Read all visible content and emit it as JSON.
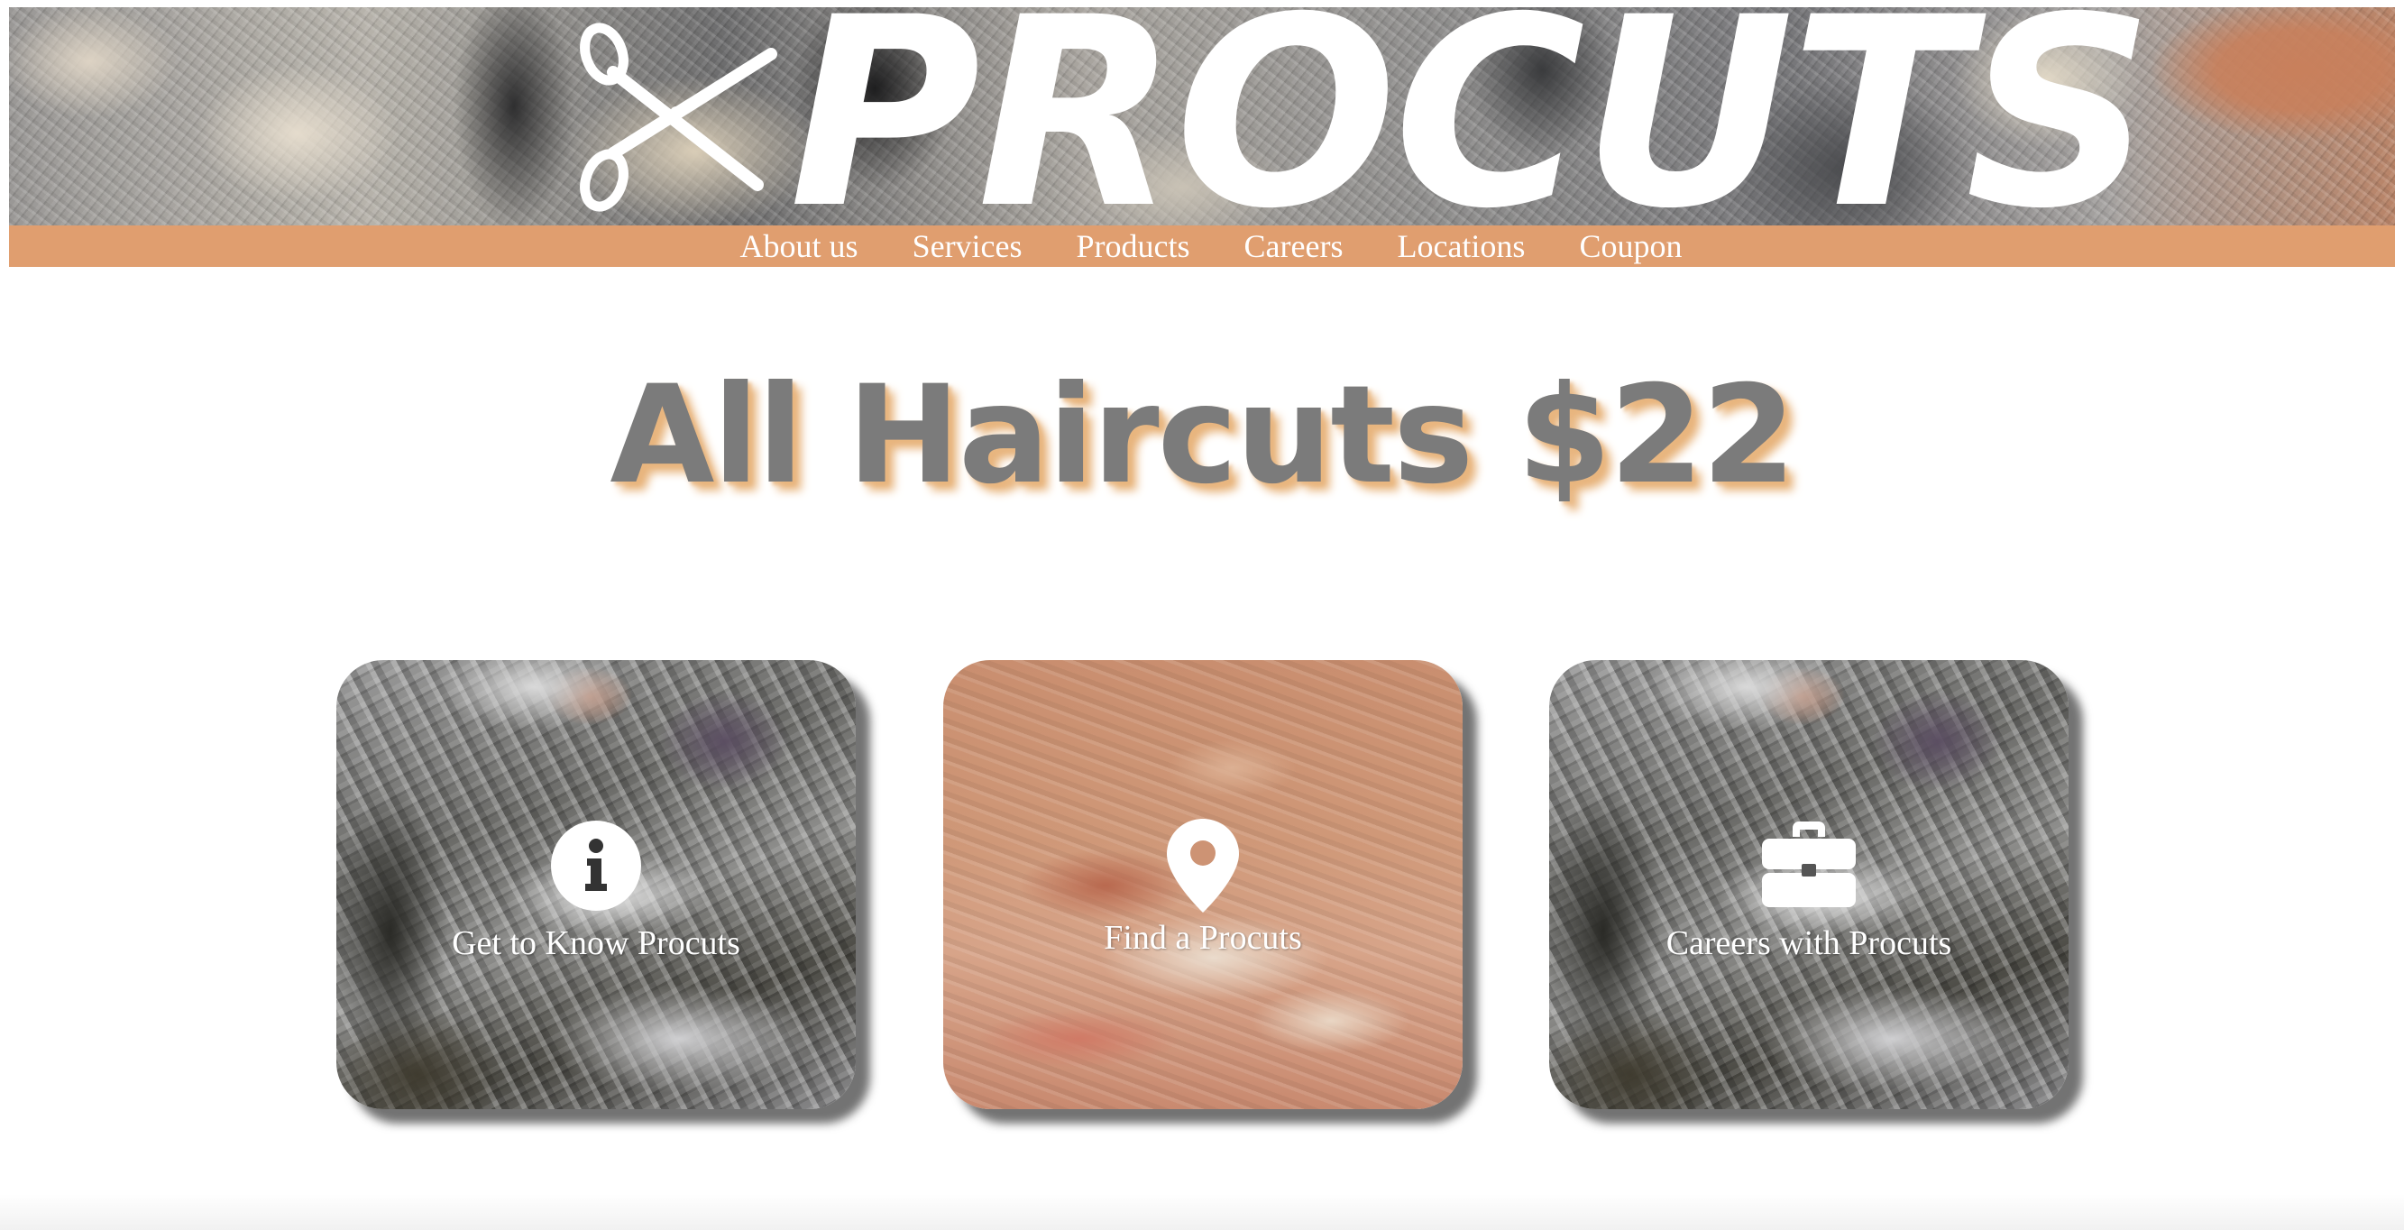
{
  "site": {
    "logo_text": "PROCUTS"
  },
  "nav": {
    "items": [
      {
        "label": "About us"
      },
      {
        "label": "Services"
      },
      {
        "label": "Products"
      },
      {
        "label": "Careers"
      },
      {
        "label": "Locations"
      },
      {
        "label": "Coupon"
      }
    ]
  },
  "headline": "All Haircuts $22",
  "cards": [
    {
      "label": "Get to Know Procuts",
      "icon": "info-icon"
    },
    {
      "label": "Find a Procuts",
      "icon": "map-pin-icon"
    },
    {
      "label": "Careers with Procuts",
      "icon": "briefcase-icon"
    }
  ],
  "colors": {
    "nav_bar": "#e09e6f",
    "headline_text": "#7b7b7b",
    "headline_shadow": "#e8b57e",
    "nav_text": "#ffffff"
  }
}
